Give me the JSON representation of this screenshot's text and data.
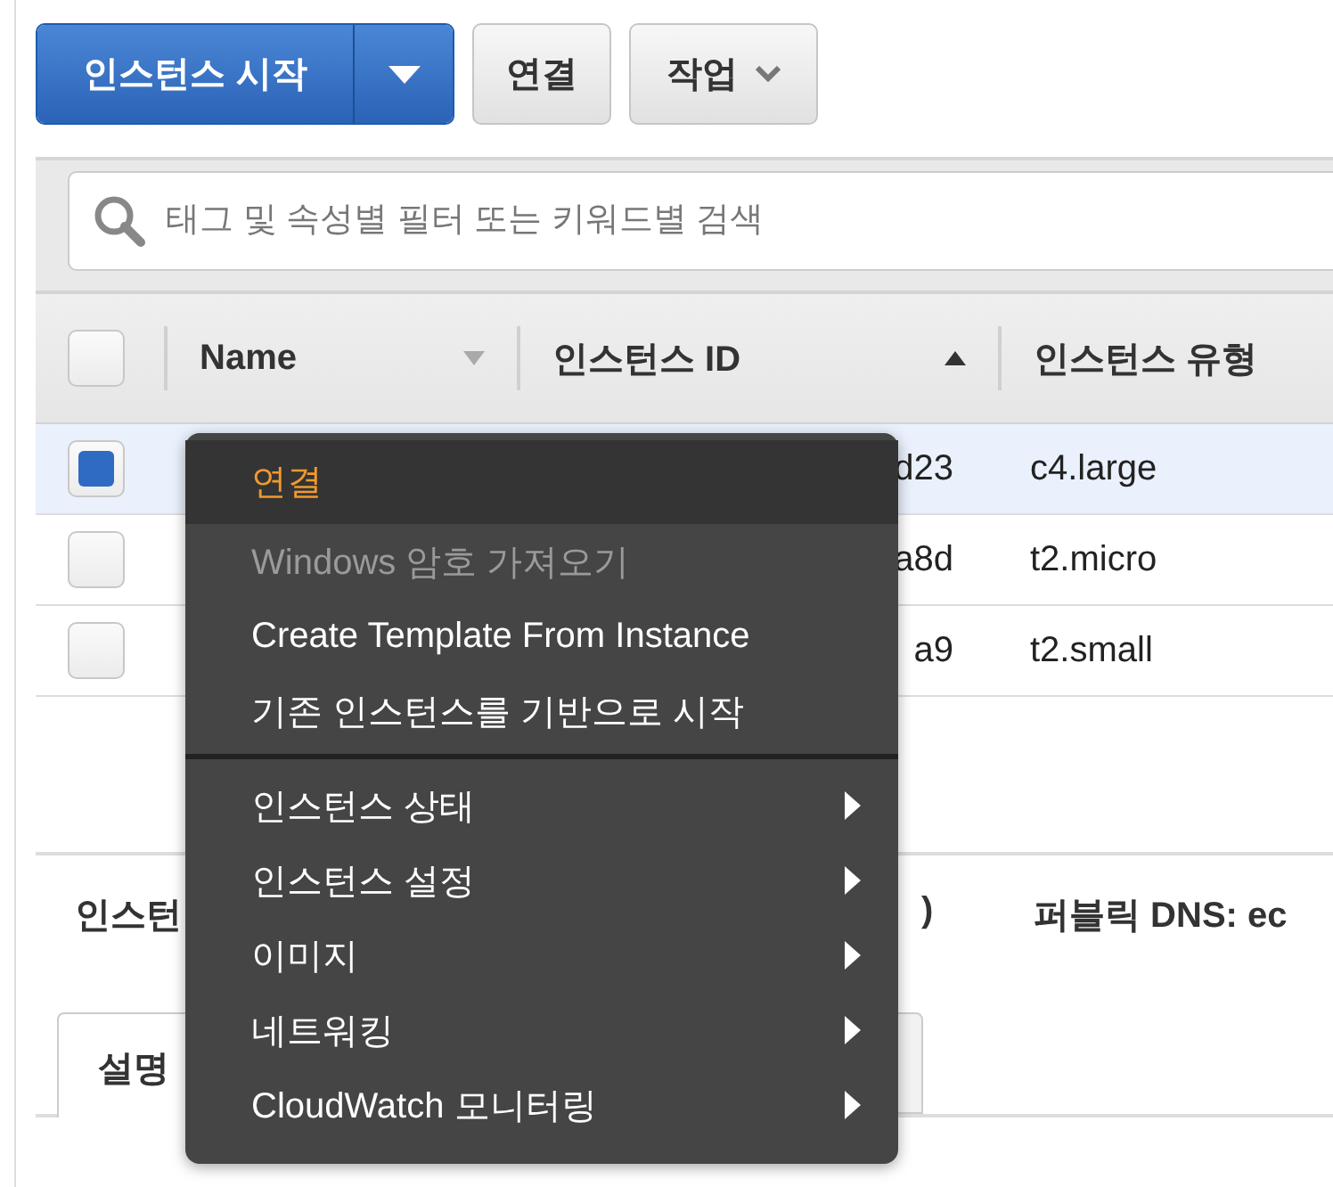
{
  "toolbar": {
    "launch_button": "인스턴스 시작",
    "connect_button": "연결",
    "actions_button": "작업"
  },
  "search": {
    "placeholder": "태그 및 속성별 필터 또는 키워드별 검색"
  },
  "table": {
    "header_checkbox": {
      "checked": false
    },
    "columns": [
      {
        "label": "Name",
        "sorted": false
      },
      {
        "label": "인스턴스 ID",
        "sorted": true
      },
      {
        "label": "인스턴스 유형"
      }
    ],
    "rows": [
      {
        "instance_id": "d23",
        "type": "c4.large",
        "selected": true,
        "checked": true
      },
      {
        "instance_id": "a8d",
        "type": "t2.micro",
        "selected": false,
        "checked": false
      },
      {
        "instance_id": "a9",
        "type": "t2.small",
        "selected": false,
        "checked": false
      }
    ]
  },
  "details": {
    "heading_parts": [
      "인스턴",
      ")"
    ],
    "public_dns": "퍼블릭 DNS: ec",
    "tabs": [
      {
        "label": "설명",
        "selected": true
      },
      {
        "selected": false
      }
    ]
  },
  "context_menu": {
    "items": [
      {
        "kind": "action",
        "label": "연결",
        "selected": true,
        "disabled": false
      },
      {
        "kind": "action",
        "label": "Windows 암호 가져오기",
        "selected": false,
        "disabled": true
      },
      {
        "kind": "action",
        "label": "Create Template From Instance",
        "selected": false,
        "disabled": false
      },
      {
        "kind": "action",
        "label": "기존 인스턴스를 기반으로 시작",
        "selected": false,
        "disabled": false
      },
      {
        "kind": "separator"
      },
      {
        "kind": "submenu",
        "label": "인스턴스 상태",
        "selected": false,
        "disabled": false
      },
      {
        "kind": "submenu",
        "label": "인스턴스 설정",
        "selected": false,
        "disabled": false
      },
      {
        "kind": "submenu",
        "label": "이미지",
        "selected": false,
        "disabled": false
      },
      {
        "kind": "submenu",
        "label": "네트워킹",
        "selected": false,
        "disabled": false
      },
      {
        "kind": "submenu",
        "label": "CloudWatch 모니터링",
        "selected": false,
        "disabled": false
      }
    ]
  }
}
